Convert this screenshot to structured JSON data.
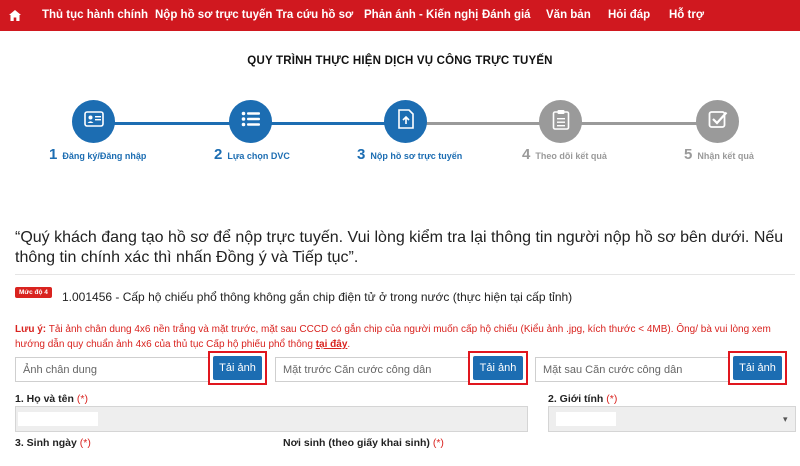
{
  "nav": {
    "home_icon": "home-icon",
    "items": [
      "Thủ tục hành chính",
      "Nộp hồ sơ trực tuyến",
      "Tra cứu hồ sơ",
      "Phản ánh - Kiến nghị",
      "Đánh giá",
      "Văn bản",
      "Hỏi đáp",
      "Hỗ trợ"
    ]
  },
  "page_title": "QUY TRÌNH THỰC HIỆN DỊCH VỤ CÔNG TRỰC TUYẾN",
  "steps": [
    {
      "num": "1",
      "label": "Đăng ký/Đăng nhập",
      "icon": "id-card-icon",
      "state": "active"
    },
    {
      "num": "2",
      "label": "Lựa chọn DVC",
      "icon": "list-icon",
      "state": "active"
    },
    {
      "num": "3",
      "label": "Nộp hồ sơ trực tuyến",
      "icon": "upload-document-icon",
      "state": "active"
    },
    {
      "num": "4",
      "label": "Theo dõi kết quả",
      "icon": "clipboard-icon",
      "state": "inactive"
    },
    {
      "num": "5",
      "label": "Nhận kết quả",
      "icon": "checkbox-icon",
      "state": "inactive"
    }
  ],
  "notice": "“Quý khách đang tạo hồ sơ để nộp trực tuyến. Vui lòng kiểm tra lại thông tin người nộp hồ sơ bên dưới. Nếu thông tin chính xác thì nhấn Đồng ý và Tiếp tục”.",
  "procedure": {
    "level_badge": "Mức độ 4",
    "title": "1.001456 - Cấp hộ chiếu phổ thông không gắn chip điện tử ở trong nước (thực hiện tại cấp tỉnh)"
  },
  "warning": {
    "label": "Lưu ý:",
    "text": " Tải ảnh chân dung 4x6 nền trắng và mặt trước, mặt sau CCCD có gắn chip của người muốn cấp hộ chiếu (Kiểu ảnh .jpg, kích thước < 4MB). Ông/ bà vui lòng xem hướng dẫn quy chuẩn ảnh 4x6 của thủ tục Cấp hộ phiếu phổ thông ",
    "link": "tại đây",
    "end": "."
  },
  "uploads": [
    {
      "placeholder": "Ảnh chân dung",
      "button": "Tải ảnh"
    },
    {
      "placeholder": "Mặt trước Căn cước công dân",
      "button": "Tải ảnh"
    },
    {
      "placeholder": "Mặt sau Căn cước công dân",
      "button": "Tải ảnh"
    }
  ],
  "form": {
    "full_name_label": "1. Họ và tên",
    "gender_label": "2. Giới tính",
    "dob_label": "3. Sinh ngày",
    "birthplace_label": "Nơi sinh (theo giấy khai sinh)",
    "required_mark": "(*)"
  },
  "colors": {
    "primary_red": "#d0181f",
    "primary_blue": "#1c6db2",
    "inactive_grey": "#9a9a9a",
    "highlight_border": "#e0161e"
  }
}
